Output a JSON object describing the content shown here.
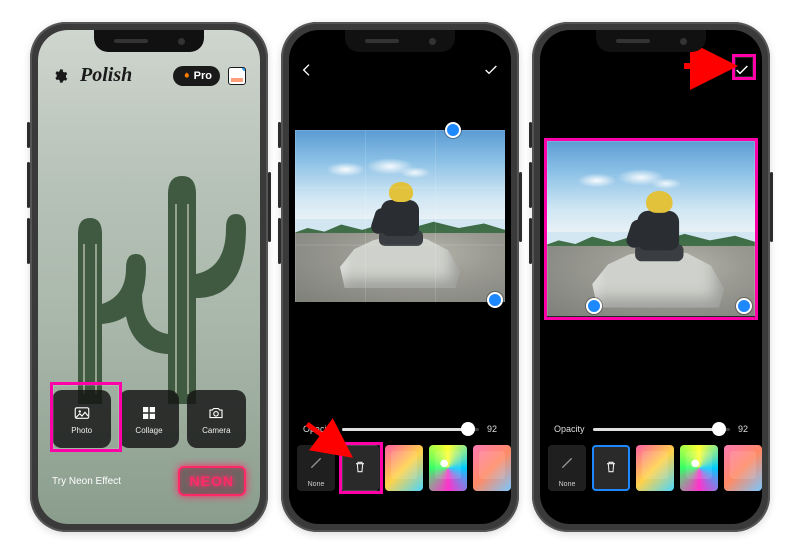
{
  "phone1": {
    "app_name": "Polish",
    "pro_label": "Pro",
    "buttons": {
      "photo": "Photo",
      "collage": "Collage",
      "camera": "Camera"
    },
    "try_effect": "Try Neon Effect",
    "neon_badge": "NEON"
  },
  "phone2": {
    "opacity_label": "Opacity",
    "opacity_value": "92",
    "none_label": "None"
  },
  "phone3": {
    "opacity_label": "Opacity",
    "opacity_value": "92",
    "none_label": "None"
  },
  "colors": {
    "highlight": "#ff00a8",
    "arrow": "#ff0000",
    "handle": "#1e88ff",
    "neon": "#ff2a68"
  }
}
